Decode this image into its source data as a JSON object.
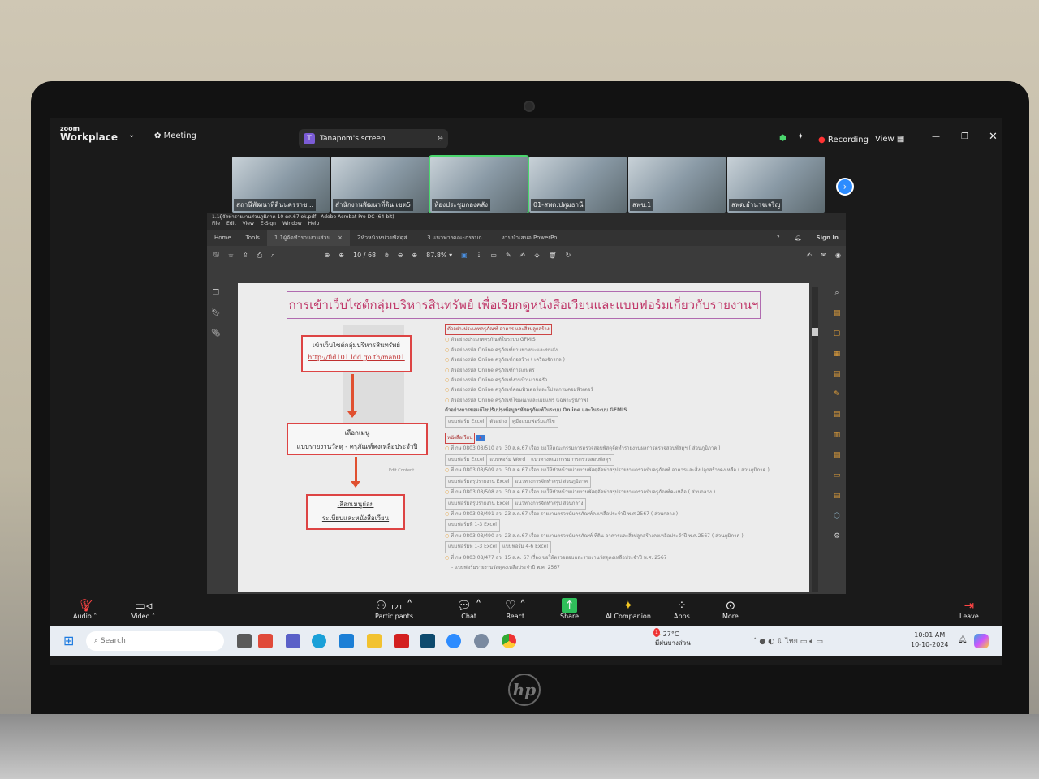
{
  "zoom": {
    "logo_top": "zoom",
    "logo_bottom": "Workplace",
    "meeting": "Meeting",
    "share_label": "Tanapom's screen",
    "share_initial": "T",
    "recording": "Recording",
    "view": "View",
    "participants": [
      {
        "name": "สถานีพัฒนาที่ดินนครราช..."
      },
      {
        "name": "สำนักงานพัฒนาที่ดิน เขต5"
      },
      {
        "name": "ห้องประชุมกองคลัง"
      },
      {
        "name": "01-สพด.ปทุมธานี"
      },
      {
        "name": "สพข.1"
      },
      {
        "name": "สพด.อำนาจเจริญ"
      }
    ],
    "controls": {
      "audio": "Audio",
      "video": "Video",
      "participants": "Participants",
      "participant_count": "121",
      "chat": "Chat",
      "react": "React",
      "share": "Share",
      "ai": "AI Companion",
      "apps": "Apps",
      "more": "More",
      "leave": "Leave"
    }
  },
  "acrobat": {
    "title": "1.1ผู้จัดทำรายงานส่วนภูมิภาค 10 ตค.67 ok.pdf - Adobe Acrobat Pro DC (64-bit)",
    "menu": [
      "File",
      "Edit",
      "View",
      "E-Sign",
      "Window",
      "Help"
    ],
    "tabs": [
      "Home",
      "Tools",
      "1.1ผู้จัดทำรายงานส่วน...",
      "2หัวหน้าหน่วยพัสดุส่...",
      "3.แนวทางคณะกรรมก...",
      "งานนำเสนอ PowerPo..."
    ],
    "sign_in": "Sign In",
    "page_current": "10",
    "page_total": "68",
    "zoom_level": "87.8%"
  },
  "doc": {
    "title": "การเข้าเว็บไซต์กลุ่มบริหารสินทรัพย์ เพื่อเรียกดูหนังสือเวียนและแบบฟอร์มเกี่ยวกับรายงานฯ",
    "step1": "เข้าเว็บไซต์กลุ่มบริหารสินทรัพย์",
    "step1_link": "http://fid101.ldd.go.th/man01",
    "step2_a": "เลือกเมนู",
    "step2_b": "แบบรายงานวัสดุ - ครุภัณฑ์คงเหลือประจำปี",
    "step3_a": "เลือกเมนูย่อย",
    "step3_b": "ระเบียบและหนังสือเวียน",
    "edit_content": "Edit Content",
    "sec1": "ตัวอย่างประเภทครุภัณฑ์ อาคาร และสิ่งปลูกสร้าง",
    "sec1_items": [
      "ตัวอย่างประเภทครุภัณฑ์ในระบบ GFMIS",
      "ตัวอย่างรหัส Online ครุภัณฑ์ยานพาหนะและขนส่ง",
      "ตัวอย่างรหัส Online ครุภัณฑ์ก่อสร้าง ( เครื่องจักรกล )",
      "ตัวอย่างรหัส Online ครุภัณฑ์การเกษตร",
      "ตัวอย่างรหัส Online ครุภัณฑ์งานบ้านงานครัว",
      "ตัวอย่างรหัส Online ครุภัณฑ์คอมพิวเตอร์และโปรแกรมคอมพิวเตอร์",
      "ตัวอย่างรหัส Online ครุภัณฑ์โฆษณาและเผยแพร่ (เฉพาะรูปภาพ)"
    ],
    "sec1_note": "ตัวอย่างการขอแก้ไขปรับปรุงข้อมูลรหัสครุภัณฑ์ในระบบ Online และในระบบ GFMIS",
    "sec1_cells": [
      "แบบฟอร์ม Excel",
      "ตัวอย่าง",
      "คู่มือแบบฟอร์มแก้ไข"
    ],
    "sec2": "หนังสือเวียน",
    "letters": [
      {
        "text": "ที่ กษ 0803.08/510 ลว. 30 ส.ค.67 เรื่อง ขอให้คณะกรรมการตรวจสอบพัสดุจัดทำรายงานผลการตรวจสอบพัสดุฯ ( ส่วนภูมิภาค )",
        "cells": [
          "แบบฟอร์ม Excel",
          "แบบฟอร์ม Word",
          "แนวทางคณะกรรมการตรวจสอบพัสดุฯ"
        ]
      },
      {
        "text": "ที่ กษ 0803.08/509 ลว. 30 ส.ค.67 เรื่อง ขอให้หัวหน้าหน่วยงานพัสดุจัดทำสรุปรายงานตรวจนับครุภัณฑ์ อาคารและสิ่งปลูกสร้างคงเหลือ ( ส่วนภูมิภาค )",
        "cells": [
          "แบบฟอร์มสรุปรายงาน Excel",
          "แนวทางการจัดทำสรุป ส่วนภูมิภาค"
        ]
      },
      {
        "text": "ที่ กษ 0803.08/508 ลว. 30 ส.ค.67 เรื่อง ขอให้หัวหน้าหน่วยงานพัสดุจัดทำสรุปรายงานตรวจนับครุภัณฑ์คงเหลือ ( ส่วนกลาง )",
        "cells": [
          "แบบฟอร์มสรุปรายงาน Excel",
          "แนวทางการจัดทำสรุป ส่วนกลาง"
        ]
      },
      {
        "text": "ที่ กษ 0803.08/491 ลว. 23 ส.ค.67 เรื่อง รายงานตรวจนับครุภัณฑ์คงเหลือประจำปี พ.ศ.2567 ( ส่วนกลาง )",
        "cells": [
          "แบบฟอร์มที่ 1-3 Excel"
        ]
      },
      {
        "text": "ที่ กษ 0803.08/490 ลว. 23 ส.ค.67 เรื่อง รายงานตรวจนับครุภัณฑ์ ที่ดิน อาคารและสิ่งปลูกสร้างคงเหลือประจำปี พ.ศ.2567 ( ส่วนภูมิภาค )",
        "cells": [
          "แบบฟอร์มที่ 1-3 Excel",
          "แบบฟอร์ม 4-6 Excel"
        ]
      },
      {
        "text": "ที่ กษ 0803.08/477 ลว. 15 ส.ค. 67 เรื่อง ขอให้ตรวจสอบและรายงานวัสดุคงเหลือประจำปี พ.ศ. 2567",
        "cells": []
      }
    ],
    "last_line": "- แบบฟอร์มรายงานวัสดุคงเหลือประจำปี พ.ศ. 2567"
  },
  "taskbar": {
    "search": "Search",
    "weather_temp": "27°C",
    "weather_desc": "มีฝนบางส่วน",
    "lang": "ไทย",
    "time": "10:01 AM",
    "date": "10-10-2024",
    "weather_badge": "1"
  },
  "brand": "hp"
}
